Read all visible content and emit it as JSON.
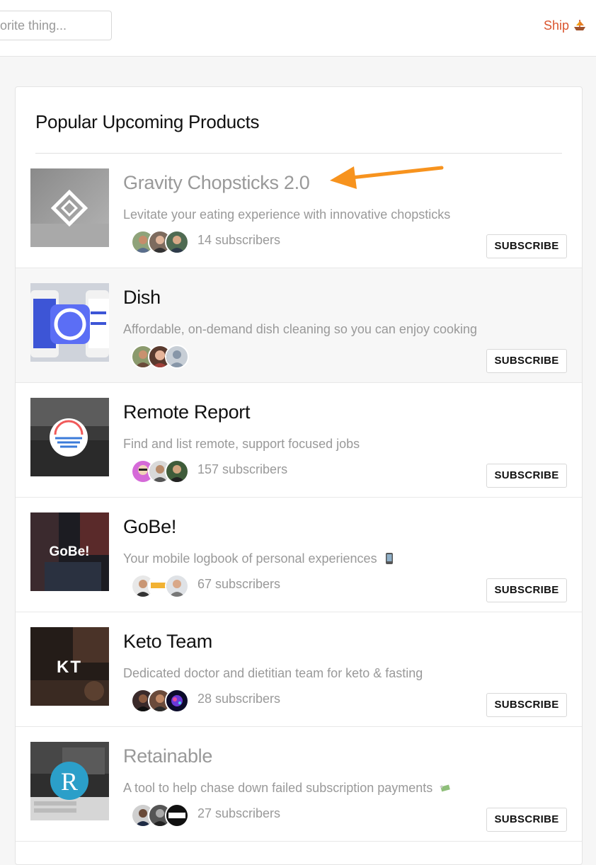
{
  "header": {
    "search_text": "vorite thing...",
    "ship_label": "Ship",
    "ship_icon": "ship-icon",
    "accent_color": "#da552f"
  },
  "section": {
    "title": "Popular Upcoming Products"
  },
  "products": [
    {
      "name": "Gravity Chopsticks 2.0",
      "tagline": "Levitate your eating experience with innovative chopsticks",
      "subscribers": "14 subscribers",
      "button": "SUBSCRIBE",
      "thumb_icon": "gravity-logo-icon"
    },
    {
      "name": "Dish",
      "tagline": "Affordable, on-demand dish cleaning so you can enjoy cooking",
      "subscribers": "",
      "button": "SUBSCRIBE",
      "thumb_icon": "dish-logo-icon"
    },
    {
      "name": "Remote Report",
      "tagline": "Find and list remote, support focused jobs",
      "subscribers": "157 subscribers",
      "button": "SUBSCRIBE",
      "thumb_icon": "remote-report-logo-icon"
    },
    {
      "name": "GoBe!",
      "tagline": "Your mobile logbook of personal experiences",
      "tagline_emoji": "mobile-phone-icon",
      "subscribers": "67 subscribers",
      "button": "SUBSCRIBE",
      "thumb_text": "GoBe!"
    },
    {
      "name": "Keto Team",
      "tagline": "Dedicated doctor and dietitian team for keto & fasting",
      "subscribers": "28 subscribers",
      "button": "SUBSCRIBE",
      "thumb_text": "KT"
    },
    {
      "name": "Retainable",
      "tagline": "A tool to help chase down failed subscription payments",
      "tagline_emoji": "money-with-wings-icon",
      "subscribers": "27 subscribers",
      "button": "SUBSCRIBE",
      "thumb_text": "R"
    }
  ],
  "annotation": {
    "arrow_color": "#f7931e"
  }
}
